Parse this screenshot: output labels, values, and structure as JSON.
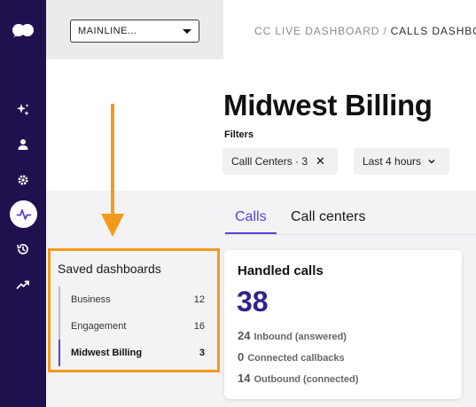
{
  "org_select": {
    "value": "MAINLINE..."
  },
  "breadcrumb": {
    "parent": "CC LIVE DASHBOARD",
    "separator": "/",
    "current": "CALLS DASHBO"
  },
  "page": {
    "title": "Midwest Billing"
  },
  "filters": {
    "label": "Filters",
    "chips": [
      {
        "label": "Calll Centers · 3"
      },
      {
        "label": "Last 4 hours"
      }
    ]
  },
  "tabs": [
    {
      "label": "Calls",
      "active": true
    },
    {
      "label": "Call centers",
      "active": false
    }
  ],
  "saved_dashboards": {
    "title": "Saved dashboards",
    "items": [
      {
        "label": "Business",
        "count": "12"
      },
      {
        "label": "Engagement",
        "count": "16"
      },
      {
        "label": "Midwest Billing",
        "count": "3",
        "active": true
      }
    ]
  },
  "handled_calls": {
    "title": "Handled calls",
    "value": "38",
    "metrics": [
      {
        "num": "24",
        "label": "Inbound (answered)"
      },
      {
        "num": "0",
        "label": "Connected callbacks"
      },
      {
        "num": "14",
        "label": "Outbound (connected)"
      }
    ]
  },
  "colors": {
    "rail": "#20114e",
    "accent": "#5b3fd6",
    "highlight": "#f39a1c",
    "metric_value": "#33228a"
  },
  "icons": {
    "rail": [
      "logo-icon",
      "sparkle-icon",
      "user-icon",
      "gear-icon",
      "activity-icon",
      "history-icon",
      "trending-up-icon"
    ]
  }
}
